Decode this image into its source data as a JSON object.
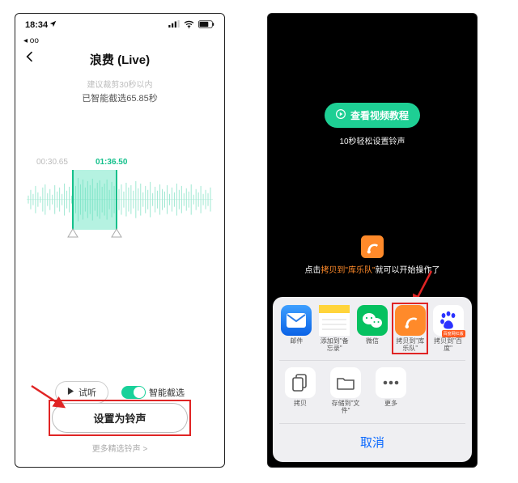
{
  "left": {
    "status": {
      "time": "18:34",
      "back_small": "◂ ᴏᴏ"
    },
    "title": "浪费 (Live)",
    "hint_small": "建议裁剪30秒以内",
    "hint_main": "已智能截选65.85秒",
    "time_start": "00:30.65",
    "time_end": "01:36.50",
    "preview_label": "试听",
    "smart_toggle_label": "智能截选",
    "set_btn_label": "设置为铃声",
    "more_link": "更多精选铃声 >"
  },
  "right": {
    "tutorial_btn": "查看视频教程",
    "tutorial_sub": "10秒轻松设置铃声",
    "instr_pre": "点击",
    "instr_hi": "拷贝到\"库乐队\"",
    "instr_post": "就可以开始操作了",
    "apps": [
      {
        "name": "mail",
        "label": "邮件"
      },
      {
        "name": "notes",
        "label": "添加到\"备忘录\""
      },
      {
        "name": "wechat",
        "label": "微信"
      },
      {
        "name": "garageband",
        "label": "拷贝到\"库乐队\""
      },
      {
        "name": "baidu",
        "label": "拷贝到\"百度\""
      }
    ],
    "actions": [
      {
        "name": "copy",
        "label": "拷贝"
      },
      {
        "name": "files",
        "label": "存储到\"文件\""
      },
      {
        "name": "more",
        "label": "更多"
      }
    ],
    "cancel": "取消"
  }
}
